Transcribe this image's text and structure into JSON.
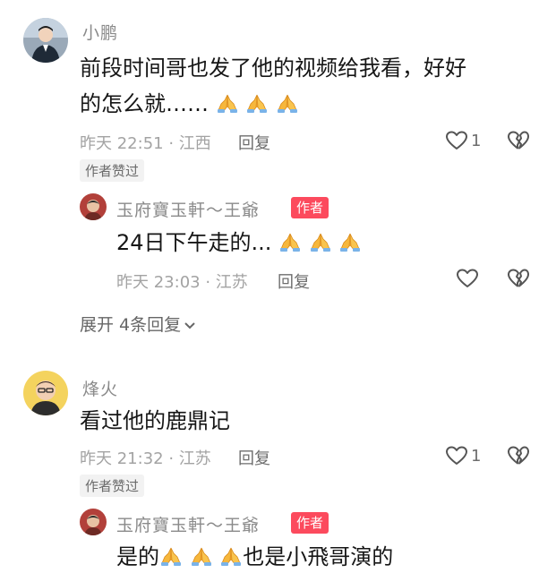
{
  "comments": [
    {
      "user": "小鹏",
      "text_line1": "前段时间哥也发了他的视频给我看，好好",
      "text_line2": "的怎么就……",
      "meta": "昨天 22:51 · 江西",
      "reply_label": "回复",
      "like_count": "1",
      "author_liked": "作者赞过",
      "reply": {
        "user": "玉府寶玉軒～王爺",
        "author_tag": "作者",
        "text": "24日下午走的...",
        "meta": "昨天 23:03 · 江苏",
        "reply_label": "回复"
      },
      "expand_label": "展开 4条回复"
    },
    {
      "user": "烽火",
      "text": "看过他的鹿鼎记",
      "meta": "昨天 21:32 · 江苏",
      "reply_label": "回复",
      "like_count": "1",
      "author_liked": "作者赞过",
      "reply": {
        "user": "玉府寶玉軒～王爺",
        "author_tag": "作者",
        "text_start": "是的",
        "text_end": "也是小飛哥演的"
      }
    }
  ],
  "icons": {
    "like": "heart-outline-icon",
    "dislike": "broken-heart-icon",
    "pray": "folded-hands-emoji",
    "expand": "chevron-down-icon"
  },
  "colors": {
    "author_tag": "#fc4a5d",
    "meta_text": "#a3a3a3",
    "name_text": "#8a8a8a"
  }
}
